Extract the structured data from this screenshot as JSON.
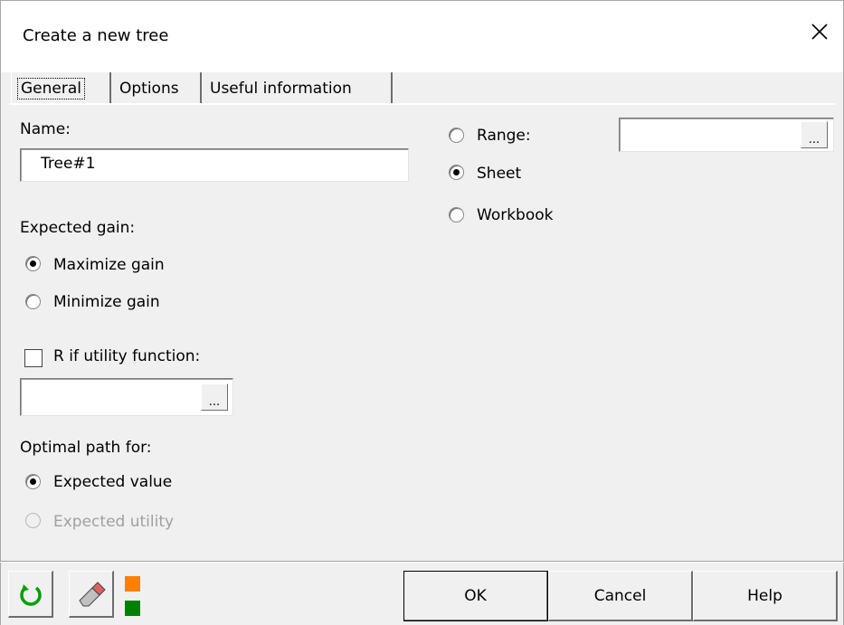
{
  "window": {
    "title": "Create a new tree"
  },
  "tabs": [
    {
      "label": "General",
      "active": true
    },
    {
      "label": "Options",
      "active": false
    },
    {
      "label": "Useful information",
      "active": false
    }
  ],
  "general": {
    "name_label": "Name:",
    "name_value": "Tree#1",
    "expected_gain_label": "Expected gain:",
    "maximize_label": "Maximize gain",
    "minimize_label": "Minimize gain",
    "utility_checkbox_label": "R if utility function:",
    "utility_value": "",
    "optimal_path_label": "Optimal path for:",
    "expected_value_label": "Expected value",
    "expected_utility_label": "Expected utility",
    "range_label": "Range:",
    "range_value": "",
    "sheet_label": "Sheet",
    "workbook_label": "Workbook",
    "browse_label": "..."
  },
  "footer": {
    "ok_label": "OK",
    "cancel_label": "Cancel",
    "help_label": "Help"
  },
  "icons": {
    "reset": "reset-icon",
    "eraser": "eraser-icon",
    "colors": "color-squares-icon"
  },
  "colors": {
    "accent_green": "#00a000",
    "orange": "#ff7f00",
    "dark_green": "#007f00"
  }
}
